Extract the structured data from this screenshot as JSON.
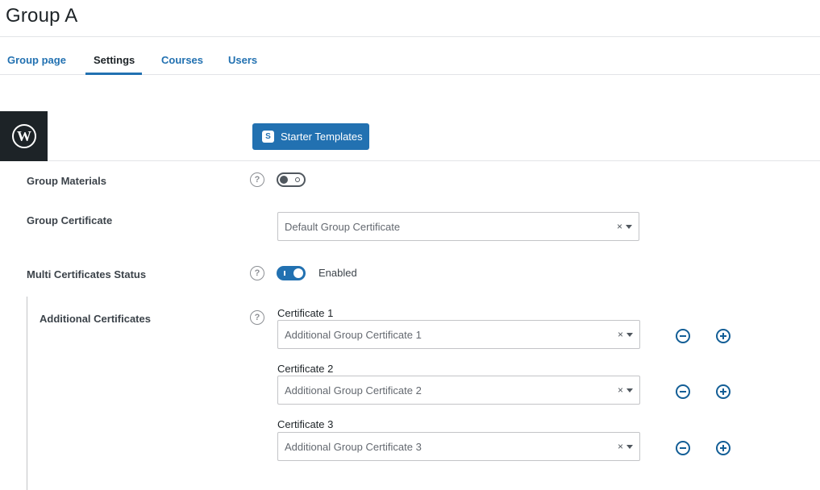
{
  "page": {
    "title": "Group A"
  },
  "tabs": [
    {
      "label": "Group page"
    },
    {
      "label": "Settings",
      "active": true
    },
    {
      "label": "Courses"
    },
    {
      "label": "Users"
    }
  ],
  "toolbar": {
    "starter_templates_label": "Starter Templates"
  },
  "settings": {
    "group_materials": {
      "label": "Group Materials",
      "enabled": false
    },
    "group_certificate": {
      "label": "Group Certificate",
      "value": "Default Group Certificate"
    },
    "multi_certificates": {
      "label": "Multi Certificates Status",
      "enabled": true,
      "status_text": "Enabled"
    },
    "additional_certificates": {
      "label": "Additional Certificates",
      "items": [
        {
          "label": "Certificate 1",
          "value": "Additional Group Certificate 1"
        },
        {
          "label": "Certificate 2",
          "value": "Additional Group Certificate 2"
        },
        {
          "label": "Certificate 3",
          "value": "Additional Group Certificate 3"
        }
      ]
    }
  },
  "icons": {
    "help": "?",
    "clear": "×",
    "logo": "wordpress-icon",
    "starter": "starter-templates-icon"
  },
  "colors": {
    "accent": "#2271b1",
    "accent_dark": "#135e96",
    "admin_dark": "#1d2327"
  }
}
